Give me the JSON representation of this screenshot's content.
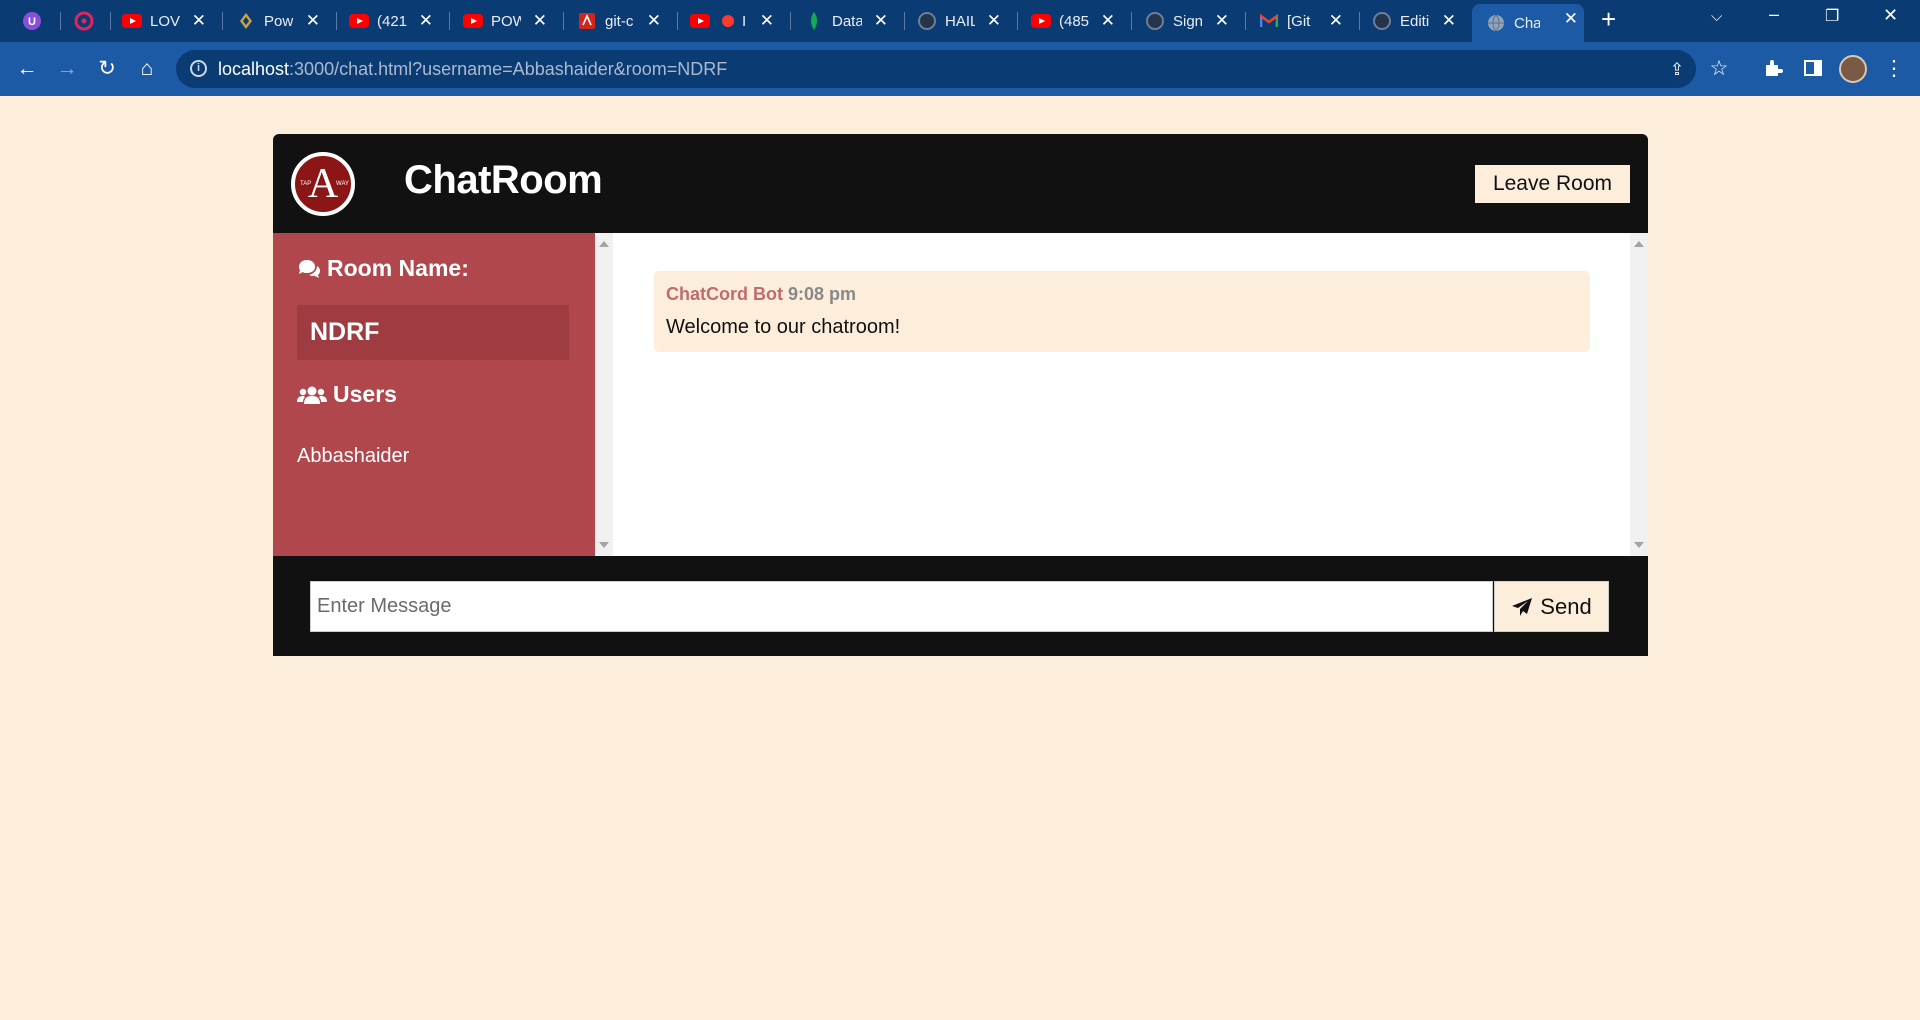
{
  "browser": {
    "tabs": [
      {
        "icon": "extension-icon",
        "label": ""
      },
      {
        "icon": "app-icon",
        "label": ""
      },
      {
        "icon": "youtube-icon",
        "label": "LOVI"
      },
      {
        "icon": "power-app-icon",
        "label": "Pow"
      },
      {
        "icon": "youtube-icon",
        "label": "(421"
      },
      {
        "icon": "youtube-icon",
        "label": "POW"
      },
      {
        "icon": "pdf-icon",
        "label": "git-c"
      },
      {
        "icon": "youtube-icon",
        "label": "I"
      },
      {
        "icon": "mongodb-icon",
        "label": "Data"
      },
      {
        "icon": "github-icon",
        "label": "HAIL"
      },
      {
        "icon": "youtube-icon",
        "label": "(485"
      },
      {
        "icon": "github-icon",
        "label": "Sign"
      },
      {
        "icon": "gmail-icon",
        "label": "[Git"
      },
      {
        "icon": "github-icon",
        "label": "Editi"
      },
      {
        "icon": "globe-icon",
        "label": "Chat"
      }
    ],
    "url_host": "localhost",
    "url_rest": ":3000/chat.html?username=Abbashaider&room=NDRF"
  },
  "header": {
    "title": "ChatRoom",
    "leave_label": "Leave Room",
    "logo_text": "A",
    "logo_left": "TAP",
    "logo_right": "WAY"
  },
  "sidebar": {
    "room_heading": "Room Name:",
    "room_name": "NDRF",
    "users_heading": "Users",
    "users": [
      "Abbashaider"
    ]
  },
  "messages": [
    {
      "username": "ChatCord Bot",
      "time": "9:08 pm",
      "text": "Welcome to our chatroom!"
    }
  ],
  "composer": {
    "placeholder": "Enter Message",
    "send_label": "Send"
  },
  "colors": {
    "page_bg": "#fdeedb",
    "header_bg": "#111111",
    "sidebar_bg": "#b0474c",
    "room_box_bg": "#9e3c42",
    "username_color": "#c06b6e",
    "browser_dark": "#0b3b73",
    "browser_light": "#1d5aa5"
  }
}
